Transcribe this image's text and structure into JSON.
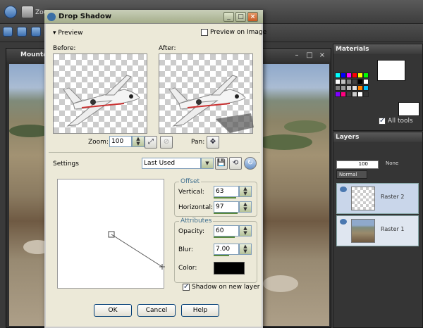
{
  "toolbar": {
    "zoom_label": "Zoom"
  },
  "document": {
    "title": "Mountain"
  },
  "materials": {
    "title": "Materials",
    "all_tools_label": "All tools",
    "swatches": [
      "#00ffff",
      "#0000ff",
      "#ff00ff",
      "#ff0000",
      "#ffff00",
      "#00ff00",
      "#ffffff",
      "#c0c0c0",
      "#808080",
      "#404040",
      "#000000",
      "#ffffff",
      "#7f7f7f",
      "#999999",
      "#bfbfbf",
      "#dfdfdf",
      "#ff7f00",
      "#00bfff",
      "#7f00ff",
      "#ff007f",
      "#3f3f3f",
      "#cccccc",
      "#ffffff",
      "#333333"
    ]
  },
  "layers": {
    "title": "Layers",
    "opacity_value": "100",
    "blend_none": "None",
    "blend_mode": "Normal",
    "items": [
      {
        "name": "Raster 2"
      },
      {
        "name": "Raster 1"
      }
    ]
  },
  "dialog": {
    "title": "Drop Shadow",
    "preview_label": "Preview",
    "preview_on_image_label": "Preview on Image",
    "before_label": "Before:",
    "after_label": "After:",
    "zoom_label": "Zoom:",
    "zoom_value": "100",
    "pan_label": "Pan:",
    "settings_label": "Settings",
    "settings_value": "Last Used",
    "offset_group": "Offset",
    "vertical_label": "Vertical:",
    "vertical_value": "63",
    "horizontal_label": "Horizontal:",
    "horizontal_value": "97",
    "attributes_group": "Attributes",
    "opacity_label": "Opacity:",
    "opacity_value": "60",
    "blur_label": "Blur:",
    "blur_value": "7.00",
    "color_label": "Color:",
    "color_value": "#000000",
    "shadow_on_new_layer_label": "Shadow on new layer",
    "ok_label": "OK",
    "cancel_label": "Cancel",
    "help_label": "Help"
  }
}
